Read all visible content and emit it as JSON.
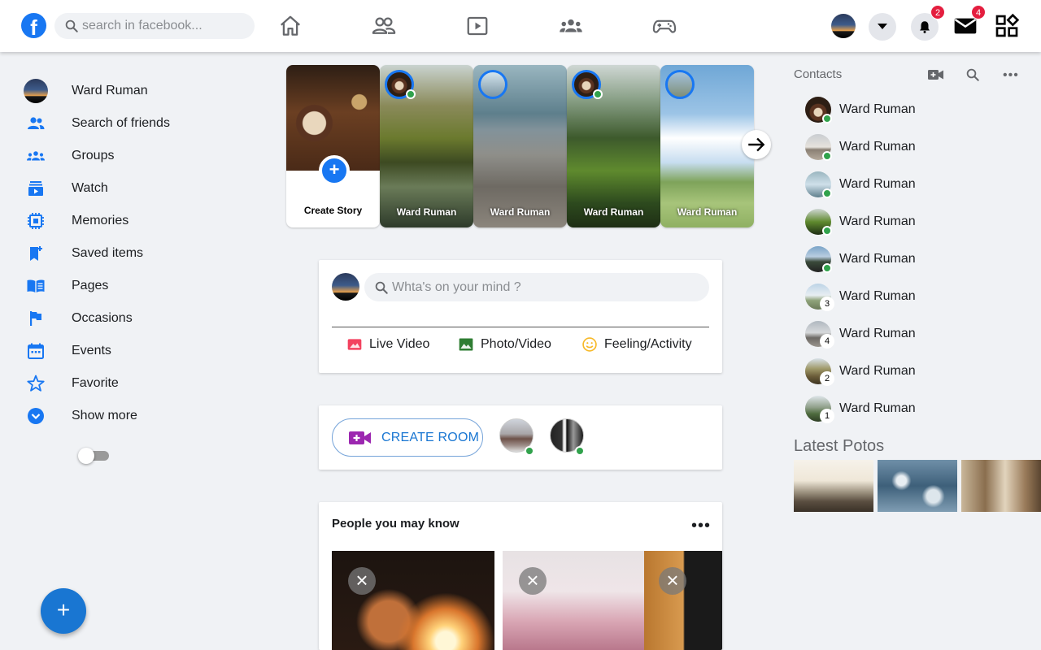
{
  "header": {
    "search_placeholder": "search in facebook...",
    "notifications_count": "2",
    "messages_count": "4"
  },
  "sidebar": {
    "profile_name": "Ward Ruman",
    "items": [
      {
        "label": "Search of friends",
        "icon": "friends-icon"
      },
      {
        "label": "Groups",
        "icon": "groups-icon"
      },
      {
        "label": "Watch",
        "icon": "watch-icon"
      },
      {
        "label": "Memories",
        "icon": "memories-icon"
      },
      {
        "label": "Saved items",
        "icon": "bookmark-icon"
      },
      {
        "label": "Pages",
        "icon": "pages-icon"
      },
      {
        "label": "Occasions",
        "icon": "flag-icon"
      },
      {
        "label": "Events",
        "icon": "calendar-icon"
      },
      {
        "label": "Favorite",
        "icon": "star-icon"
      },
      {
        "label": "Show more",
        "icon": "chevron-down-icon"
      }
    ]
  },
  "stories": {
    "create_label": "Create Story",
    "items": [
      {
        "name": "Ward Ruman"
      },
      {
        "name": "Ward Ruman"
      },
      {
        "name": "Ward Ruman"
      },
      {
        "name": "Ward Ruman"
      }
    ]
  },
  "composer": {
    "placeholder": "Whta's on your mind ?",
    "live_video": "Live Video",
    "photo_video": "Photo/Video",
    "feeling_activity": "Feeling/Activity"
  },
  "rooms": {
    "create_room": "CREATE ROOM"
  },
  "pymk": {
    "title": "People you may know"
  },
  "contacts": {
    "title": "Contacts",
    "list": [
      {
        "name": "Ward Ruman",
        "status": "online",
        "badge": ""
      },
      {
        "name": "Ward Ruman",
        "status": "online",
        "badge": ""
      },
      {
        "name": "Ward Ruman",
        "status": "online",
        "badge": ""
      },
      {
        "name": "Ward Ruman",
        "status": "online",
        "badge": ""
      },
      {
        "name": "Ward Ruman",
        "status": "online",
        "badge": ""
      },
      {
        "name": "Ward Ruman",
        "status": "away",
        "badge": "3"
      },
      {
        "name": "Ward Ruman",
        "status": "away",
        "badge": "4"
      },
      {
        "name": "Ward Ruman",
        "status": "away",
        "badge": "2"
      },
      {
        "name": "Ward Ruman",
        "status": "away",
        "badge": "1"
      }
    ]
  },
  "latest_photos": {
    "title": "Latest Potos"
  },
  "colors": {
    "brand": "#1877f2",
    "accent": "#1976d2",
    "online": "#31a24c",
    "badge": "#e41e3f"
  }
}
